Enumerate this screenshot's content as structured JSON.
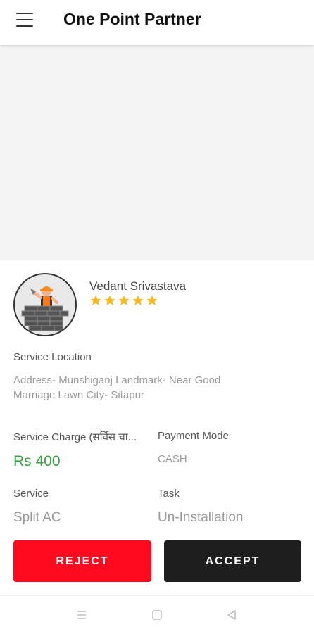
{
  "header": {
    "title": "One Point Partner",
    "menu_icon": "hamburger-menu-icon"
  },
  "customer": {
    "name": "Vedant Srivastava",
    "rating": 5,
    "star_color": "#f5b921"
  },
  "location": {
    "label": "Service Location",
    "address_line1": "Address- Munshiganj Landmark- Near Good",
    "address_line2": "Marriage Lawn City- Sitapur"
  },
  "charge": {
    "label": "Service Charge (सर्विस चा...",
    "value": "Rs 400",
    "color": "#3aa142"
  },
  "payment": {
    "label": "Payment Mode",
    "value": "CASH"
  },
  "service": {
    "label": "Service",
    "value": "Split AC"
  },
  "task": {
    "label": "Task",
    "value": "Un-Installation"
  },
  "actions": {
    "reject_label": "REJECT",
    "accept_label": "ACCEPT",
    "reject_color": "#ff0a1e",
    "accept_color": "#1e1e1e"
  },
  "system_nav": {
    "recents_icon": "recents-icon",
    "home_icon": "home-icon",
    "back_icon": "back-icon"
  }
}
